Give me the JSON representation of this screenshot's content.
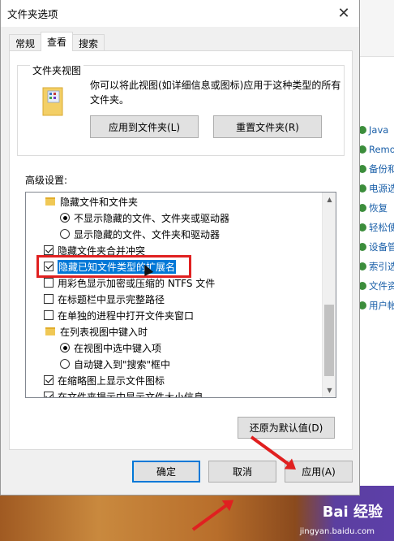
{
  "dialog": {
    "title": "文件夹选项",
    "close_glyph": "✕",
    "tabs": [
      "常规",
      "查看",
      "搜索"
    ],
    "folder_view": {
      "group_label": "文件夹视图",
      "description": "你可以将此视图(如详细信息或图标)应用于这种类型的所有文件夹。",
      "apply_button": "应用到文件夹(L)",
      "reset_button": "重置文件夹(R)"
    },
    "advanced_label": "高级设置:",
    "advanced_items": [
      {
        "kind": "folder",
        "label": "隐藏文件和文件夹"
      },
      {
        "kind": "radio",
        "checked": true,
        "label": "不显示隐藏的文件、文件夹或驱动器"
      },
      {
        "kind": "radio",
        "checked": false,
        "label": "显示隐藏的文件、文件夹和驱动器"
      },
      {
        "kind": "checkbox",
        "checked": true,
        "label": "隐藏文件夹合并冲突"
      },
      {
        "kind": "checkbox",
        "checked": true,
        "label": "隐藏已知文件类型的扩展名",
        "selected": true
      },
      {
        "kind": "checkbox",
        "checked": false,
        "label": "用彩色显示加密或压缩的 NTFS 文件"
      },
      {
        "kind": "checkbox",
        "checked": false,
        "label": "在标题栏中显示完整路径"
      },
      {
        "kind": "checkbox",
        "checked": false,
        "label": "在单独的进程中打开文件夹窗口"
      },
      {
        "kind": "folder",
        "label": "在列表视图中键入时"
      },
      {
        "kind": "radio",
        "checked": true,
        "label": "在视图中选中键入项"
      },
      {
        "kind": "radio",
        "checked": false,
        "label": "自动键入到\"搜索\"框中"
      },
      {
        "kind": "checkbox",
        "checked": true,
        "label": "在缩略图上显示文件图标"
      },
      {
        "kind": "checkbox",
        "checked": true,
        "label": "在文件夹提示中显示文件大小信息"
      }
    ],
    "restore_button": "还原为默认值(D)",
    "ok_button": "确定",
    "cancel_button": "取消",
    "apply_button": "应用(A)"
  },
  "background_items": [
    "Java",
    "Remo",
    "备份和",
    "电源选",
    "恢复",
    "轻松使",
    "设备管",
    "索引选",
    "文件资",
    "用户帐"
  ],
  "watermark": {
    "text": "Bai 经验",
    "sub": "jingyan.baidu.com"
  },
  "colors": {
    "selection": "#0078d7",
    "annotation": "#e02020"
  }
}
